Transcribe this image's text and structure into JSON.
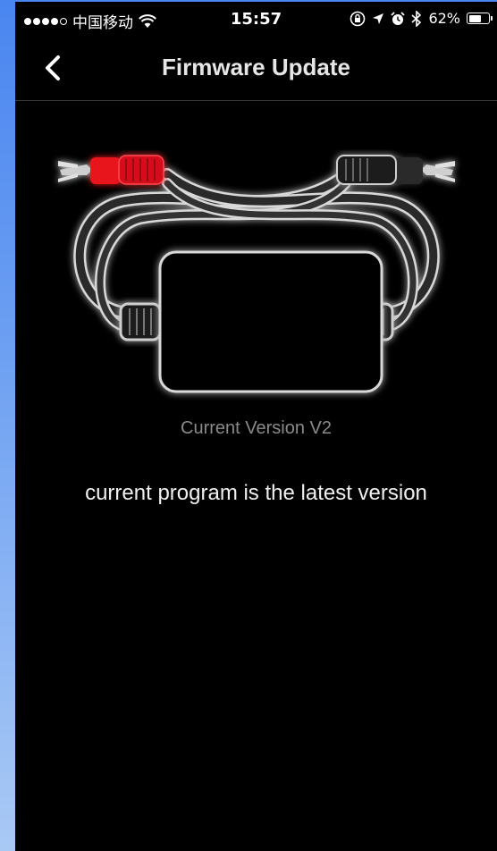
{
  "status_bar": {
    "carrier": "中国移动",
    "time": "15:57",
    "battery_text": "62%",
    "battery_level": 0.62,
    "icons": [
      "signal-dots-icon",
      "wifi-icon",
      "lock-rotation-icon",
      "location-icon",
      "alarm-icon",
      "bluetooth-icon",
      "battery-icon"
    ]
  },
  "nav": {
    "title": "Firmware Update",
    "back_icon": "chevron-left-icon"
  },
  "device": {
    "illustration": "rca-cable-device-icon",
    "colors": {
      "red_plug": "#e8141c",
      "black_plug": "#2a2a2a",
      "glow": "#ffffff"
    }
  },
  "content": {
    "version_label": "Current Version V2",
    "message": "current program is the latest version"
  }
}
